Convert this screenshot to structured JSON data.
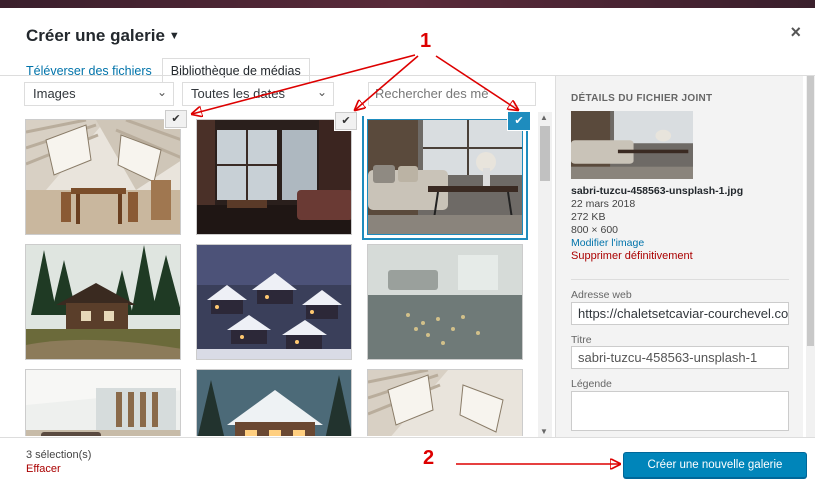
{
  "modal": {
    "title": "Créer une galerie",
    "title_caret": "▼",
    "close_glyph": "×"
  },
  "tabs": [
    {
      "label": "Téléverser des fichiers"
    },
    {
      "label": "Bibliothèque de médias"
    }
  ],
  "filters": {
    "type": "Images",
    "date": "Toutes les dates",
    "search_placeholder": "Rechercher des mé"
  },
  "grid": {
    "check_glyph": "✔",
    "items": [
      {
        "name": "attic-dining",
        "selected": true,
        "checked_style": "gray"
      },
      {
        "name": "dark-living",
        "selected": true,
        "checked_style": "gray"
      },
      {
        "name": "sofa-table",
        "selected": true,
        "checked_style": "blue"
      },
      {
        "name": "forest-cabin",
        "selected": false
      },
      {
        "name": "snow-village",
        "selected": false
      },
      {
        "name": "flooded-room",
        "selected": false
      },
      {
        "name": "bright-living",
        "selected": false
      },
      {
        "name": "snow-chalet",
        "selected": false
      },
      {
        "name": "attic-dining-2",
        "selected": false
      }
    ]
  },
  "details": {
    "heading": "DÉTAILS DU FICHIER JOINT",
    "filename": "sabri-tuzcu-458563-unsplash-1.jpg",
    "date": "22 mars 2018",
    "size": "272 KB",
    "dimensions": "800 × 600",
    "edit_link": "Modifier l'image",
    "delete_link": "Supprimer définitivement",
    "url_label": "Adresse web",
    "url_value": "https://chaletsetcaviar-courchevel.com",
    "title_label": "Titre",
    "title_value": "sabri-tuzcu-458563-unsplash-1",
    "caption_label": "Légende",
    "caption_value": ""
  },
  "footer": {
    "count": "3 sélection(s)",
    "clear": "Effacer",
    "create_button": "Créer une nouvelle galerie"
  },
  "annotations": {
    "label_1": "1",
    "label_2": "2",
    "color": "#dd0000"
  },
  "colors": {
    "accent": "#0085ba",
    "link": "#0073aa",
    "danger": "#aa0000"
  }
}
